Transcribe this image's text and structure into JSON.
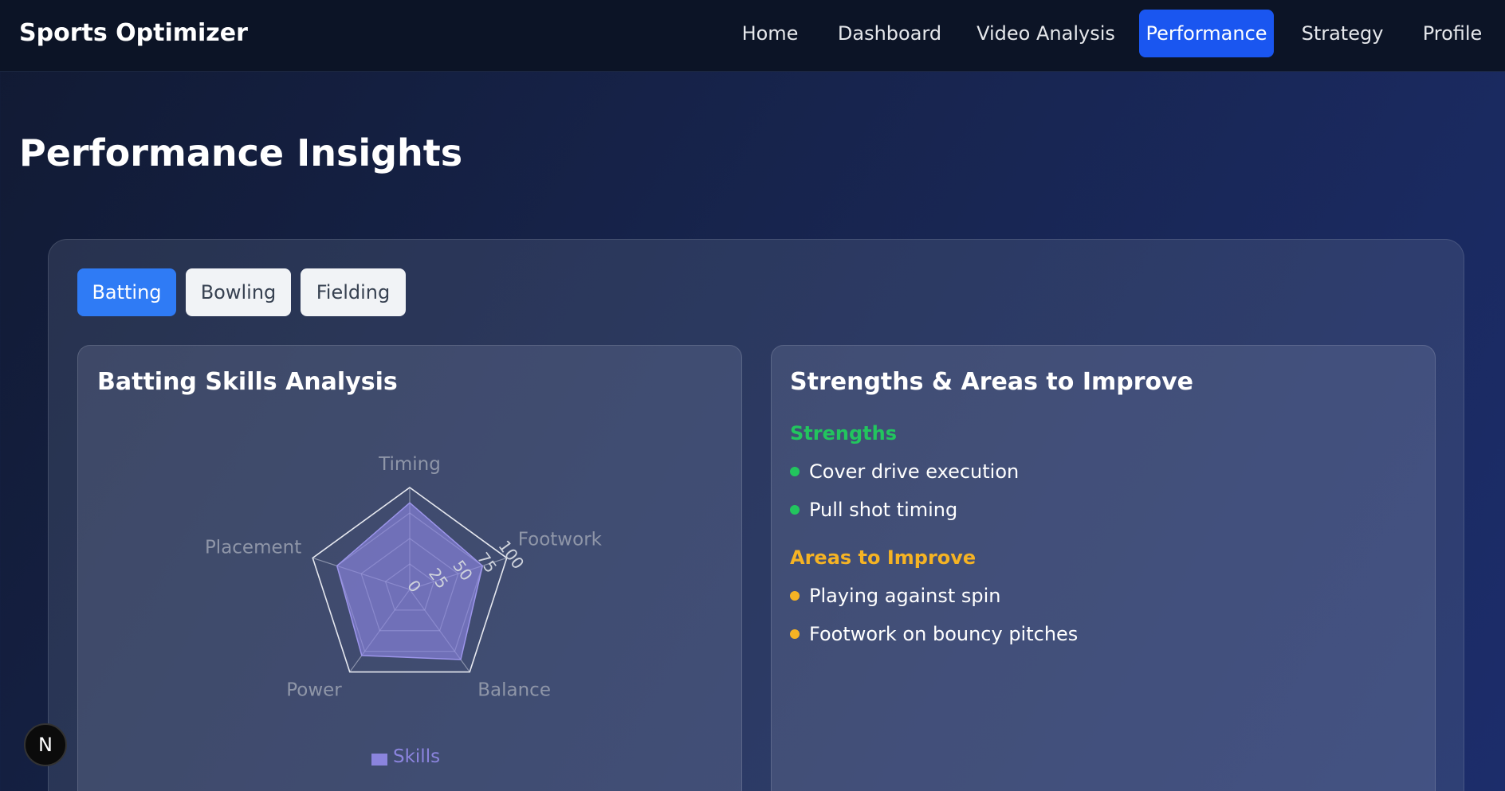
{
  "app": {
    "brand": "Sports Optimizer"
  },
  "nav": {
    "items": [
      {
        "label": "Home"
      },
      {
        "label": "Dashboard"
      },
      {
        "label": "Video Analysis"
      },
      {
        "label": "Performance"
      },
      {
        "label": "Strategy"
      },
      {
        "label": "Profile"
      }
    ],
    "active": "Performance"
  },
  "page": {
    "title": "Performance Insights"
  },
  "tabs": {
    "items": [
      {
        "label": "Batting"
      },
      {
        "label": "Bowling"
      },
      {
        "label": "Fielding"
      }
    ],
    "active": "Batting"
  },
  "skills_card": {
    "title": "Batting Skills Analysis"
  },
  "strengths_card": {
    "title": "Strengths & Areas to Improve",
    "strengths_heading": "Strengths",
    "strengths": [
      "Cover drive execution",
      "Pull shot timing"
    ],
    "improve_heading": "Areas to Improve",
    "improve": [
      "Playing against spin",
      "Footwork on bouncy pitches"
    ]
  },
  "colors": {
    "strength": "#22c55e",
    "improve": "#f5b324",
    "accent": "#1a56f0",
    "radar_fill": "#8b84de"
  },
  "badge": {
    "letter": "N"
  },
  "chart_data": {
    "type": "radar",
    "categories": [
      "Timing",
      "Footwork",
      "Balance",
      "Power",
      "Placement"
    ],
    "series": [
      {
        "name": "Skills",
        "values": [
          85,
          75,
          85,
          80,
          75
        ]
      }
    ],
    "rlim": [
      0,
      100
    ],
    "ticks": [
      "0",
      "25",
      "50",
      "75",
      "100"
    ],
    "legend": "bottom",
    "grid": true
  }
}
